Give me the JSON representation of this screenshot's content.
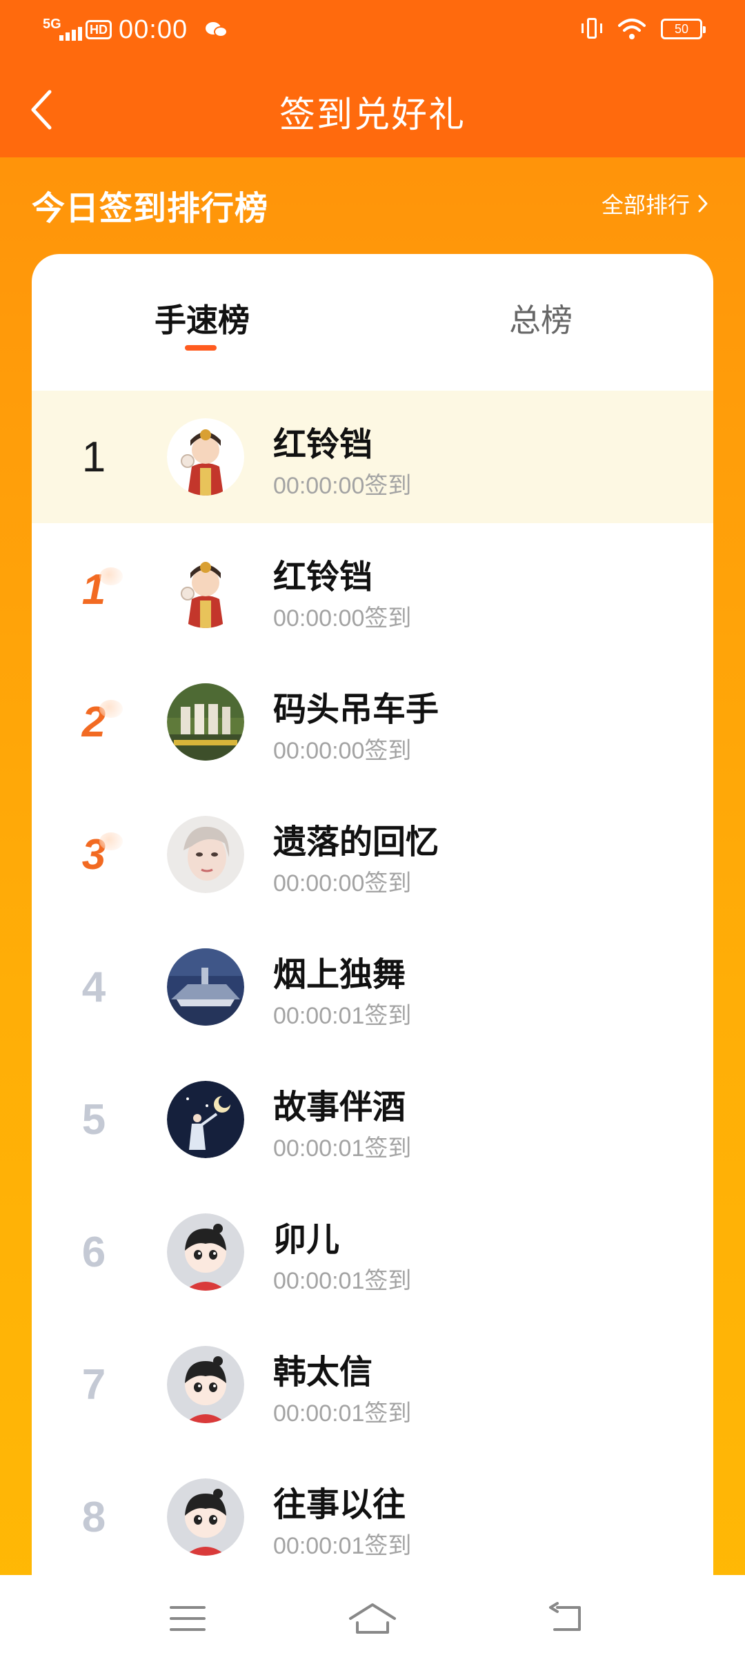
{
  "status_bar": {
    "network": "5G",
    "hd": "HD",
    "time": "00:00",
    "battery": "50"
  },
  "header": {
    "title": "签到兑好礼",
    "back_icon": "chevron-left-icon"
  },
  "section": {
    "title": "今日签到排行榜",
    "all_rank_label": "全部排行"
  },
  "tabs": [
    {
      "label": "手速榜",
      "active": true
    },
    {
      "label": "总榜",
      "active": false
    }
  ],
  "my_row": {
    "rank": "1",
    "name": "红铃铛",
    "time": "00:00:00签到"
  },
  "rows": [
    {
      "rank": "1",
      "name": "红铃铛",
      "time": "00:00:00签到"
    },
    {
      "rank": "2",
      "name": "码头吊车手",
      "time": "00:00:00签到"
    },
    {
      "rank": "3",
      "name": "遗落的回忆",
      "time": "00:00:00签到"
    },
    {
      "rank": "4",
      "name": "烟上独舞",
      "time": "00:00:01签到"
    },
    {
      "rank": "5",
      "name": "故事伴酒",
      "time": "00:00:01签到"
    },
    {
      "rank": "6",
      "name": "卯儿",
      "time": "00:00:01签到"
    },
    {
      "rank": "7",
      "name": "韩太信",
      "time": "00:00:01签到"
    },
    {
      "rank": "8",
      "name": "往事以往",
      "time": "00:00:01签到"
    }
  ],
  "colors": {
    "header": "#ff6a0d",
    "accent": "#ff5b1f",
    "top_rank": "#f26a22",
    "highlight_row": "#fdf8e3"
  },
  "bottom_nav": {
    "icons": [
      "menu-icon",
      "home-icon",
      "back-icon"
    ]
  }
}
